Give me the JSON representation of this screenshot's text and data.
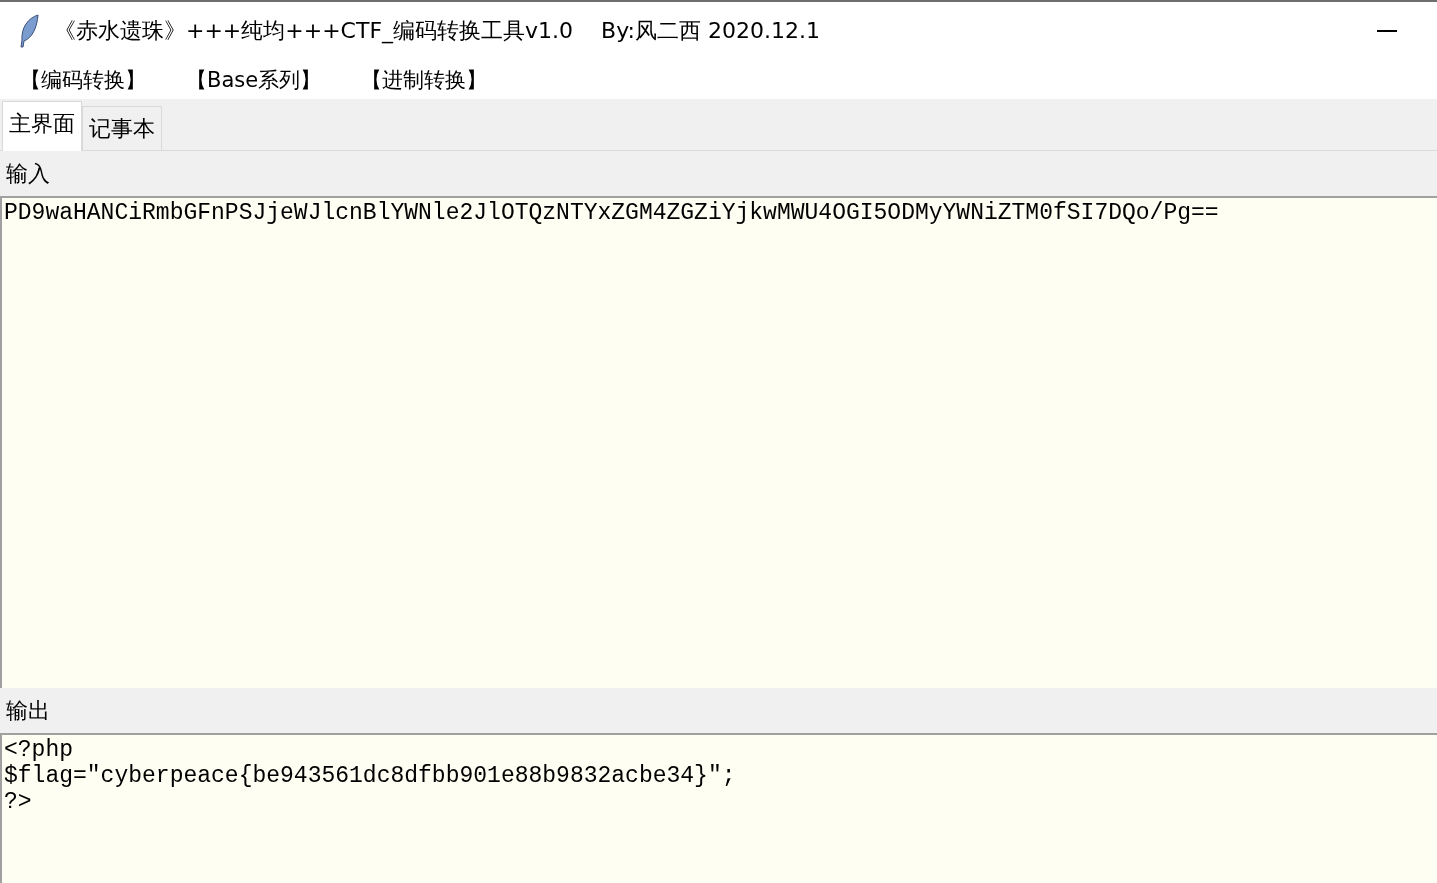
{
  "window": {
    "title": "《赤水遗珠》+++纯均+++CTF_编码转换工具v1.0    By:风二西 2020.12.1"
  },
  "menu": [
    "【编码转换】",
    "【Base系列】",
    "【进制转换】"
  ],
  "tabs": [
    {
      "label": "主界面",
      "selected": true
    },
    {
      "label": "记事本",
      "selected": false
    }
  ],
  "input": {
    "label": "输入",
    "value": "PD9waHANCiRmbGFnPSJjeWJlcnBlYWNle2JlOTQzNTYxZGM4ZGZiYjkwMWU4OGI5ODMyYWNiZTM0fSI7DQo/Pg=="
  },
  "output": {
    "label": "输出",
    "value": "<?php\n$flag=\"cyberpeace{be943561dc8dfbb901e88b9832acbe34}\";\n?>"
  }
}
